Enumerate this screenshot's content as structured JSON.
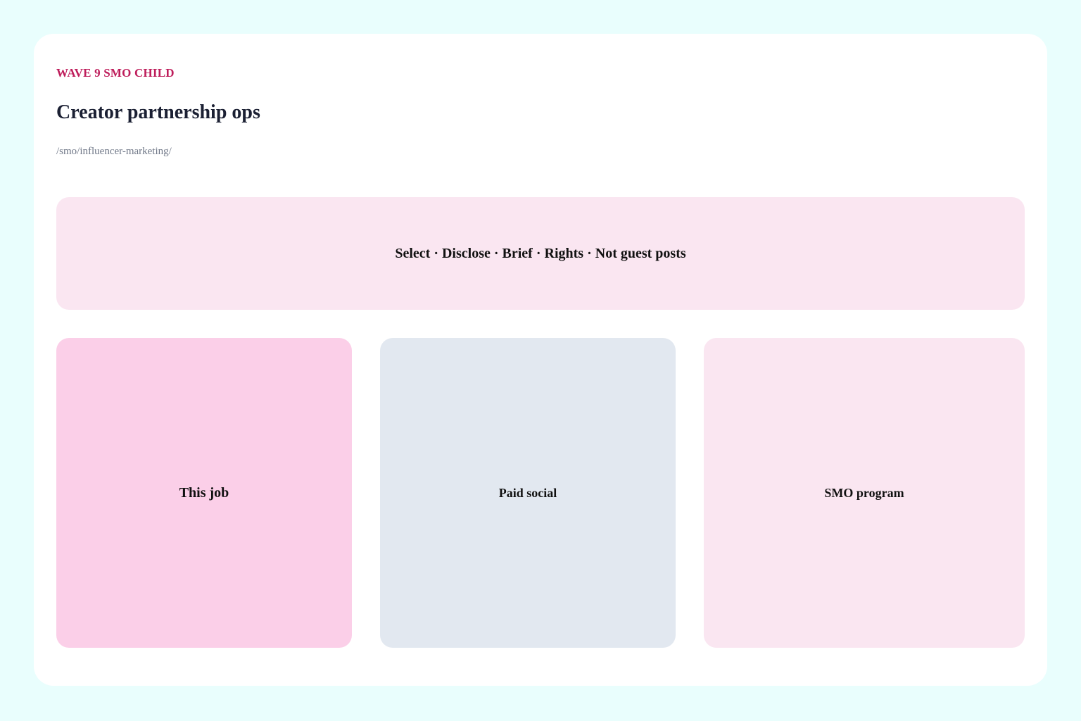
{
  "header": {
    "eyebrow": "WAVE 9 SMO CHILD",
    "title": "Creator partnership ops",
    "path": "/smo/influencer-marketing/"
  },
  "banner": {
    "text": "Select · Disclose · Brief · Rights · Not guest posts"
  },
  "tiles": [
    {
      "label": "This job",
      "color": "#fbcfe8"
    },
    {
      "label": "Paid social",
      "color": "#e2e8f0"
    },
    {
      "label": "SMO program",
      "color": "#fae6f1"
    }
  ],
  "colors": {
    "page_background": "#e9fefd",
    "card_background": "#ffffff",
    "eyebrow": "#be1d5b",
    "banner_background": "#fae6f1"
  }
}
